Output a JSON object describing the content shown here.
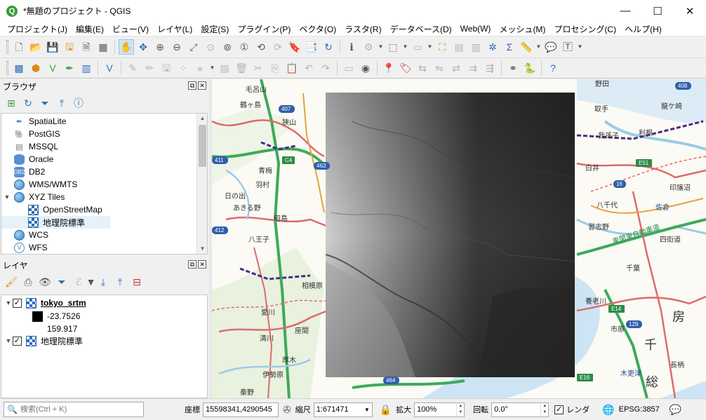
{
  "window": {
    "title": "*無題のプロジェクト - QGIS",
    "app_icon": "Q",
    "controls": {
      "minimize": "—",
      "maximize": "☐",
      "close": "✕"
    }
  },
  "menubar": [
    "プロジェクト(J)",
    "編集(E)",
    "ビュー(V)",
    "レイヤ(L)",
    "設定(S)",
    "プラグイン(P)",
    "ベクタ(O)",
    "ラスタ(R)",
    "データベース(D)",
    "Web(W)",
    "メッシュ(M)",
    "プロセシング(C)",
    "ヘルプ(H)"
  ],
  "browser_panel": {
    "title": "ブラウザ",
    "items": [
      {
        "label": "SpatiaLite",
        "icon": "spatialite-icon"
      },
      {
        "label": "PostGIS",
        "icon": "postgis-icon"
      },
      {
        "label": "MSSQL",
        "icon": "mssql-icon"
      },
      {
        "label": "Oracle",
        "icon": "oracle-icon"
      },
      {
        "label": "DB2",
        "icon": "db2-icon"
      },
      {
        "label": "WMS/WMTS",
        "icon": "wms-icon"
      },
      {
        "label": "XYZ Tiles",
        "icon": "xyz-icon"
      },
      {
        "label": "OpenStreetMap",
        "icon": "tile-icon"
      },
      {
        "label": "地理院標準",
        "icon": "tile-icon"
      },
      {
        "label": "WCS",
        "icon": "wcs-icon"
      },
      {
        "label": "WFS",
        "icon": "wfs-icon"
      }
    ]
  },
  "layers_panel": {
    "title": "レイヤ",
    "layers": [
      {
        "name": "tokyo_srtm",
        "checked": true,
        "min": "-23.7526",
        "max": "159.917"
      },
      {
        "name": "地理院標準",
        "checked": true
      }
    ]
  },
  "map": {
    "labels": [
      "毛呂山",
      "鶴ヶ島",
      "狭山",
      "青梅",
      "羽村",
      "日の出",
      "あきる野",
      "昭島",
      "八王子",
      "相模原",
      "愛川",
      "座間",
      "清川",
      "厚木",
      "伊勢原",
      "秦野",
      "野田",
      "取手",
      "龍ケ崎",
      "利根",
      "我孫子",
      "白井",
      "印旛沼",
      "八千代",
      "佐倉",
      "四街道",
      "習志野",
      "千葉",
      "養老川",
      "市原",
      "木更津",
      "長柄",
      "房",
      "千",
      "総",
      "東関東自動車道"
    ],
    "road_shields": [
      "407",
      "C4",
      "411",
      "463",
      "16",
      "E16",
      "464",
      "E51",
      "412",
      "129",
      "E14",
      "408"
    ],
    "raster_layer": "tokyo_srtm"
  },
  "statusbar": {
    "search_placeholder": "検索(Ctrl + K)",
    "coord_label": "座標",
    "coord_value": "15598341,4290545",
    "scale_label": "縮尺",
    "scale_value": "1:671471",
    "magnifier_label": "拡大",
    "magnifier_value": "100%",
    "rotation_label": "回転",
    "rotation_value": "0.0°",
    "render_label": "レンダ",
    "render_checked": true,
    "crs": "EPSG:3857"
  },
  "colors": {
    "map_water": "#c8e2f5",
    "map_land": "#fbfaf4",
    "map_green": "#cfe6c0",
    "road_red": "#dd6b6b",
    "expressway_green": "#3daa5b",
    "raster_dark": "#2a2a2a",
    "raster_light": "#d0d0d0"
  }
}
